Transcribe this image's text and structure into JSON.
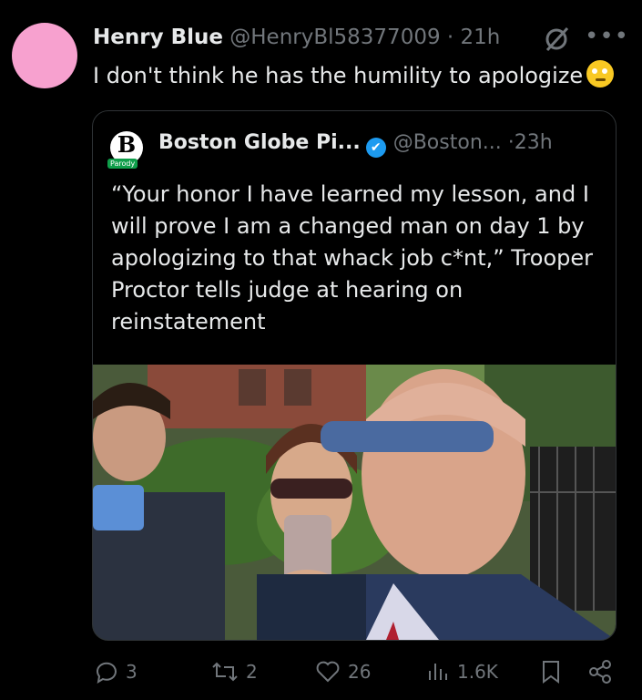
{
  "post": {
    "author_name": "Henry Blue",
    "author_handle": "@HenryBl58377009",
    "separator": "·",
    "time": "21h",
    "text": "I don't think he has the humility to apologize",
    "emoji": "face-with-rolling-eyes-emoji",
    "avatar_color": "#f7a1cf"
  },
  "quote": {
    "logo_letter": "B",
    "logo_badge": "Parody",
    "author_name": "Boston Globe Pi...",
    "author_handle": "@Boston...",
    "separator": "·",
    "time": "23h",
    "text": "“Your honor I have learned my lesson, and I will prove I am a changed man on day 1 by apologizing to that whack job c*nt,” Trooper Proctor tells judge at hearing on reinstatement",
    "verified_color": "#1d9bf0"
  },
  "actions": {
    "replies": "3",
    "reposts": "2",
    "likes": "26",
    "views": "1.6K"
  },
  "colors": {
    "background": "#000000",
    "text": "#e7e9ea",
    "muted": "#71767b",
    "border": "#2f3336"
  }
}
